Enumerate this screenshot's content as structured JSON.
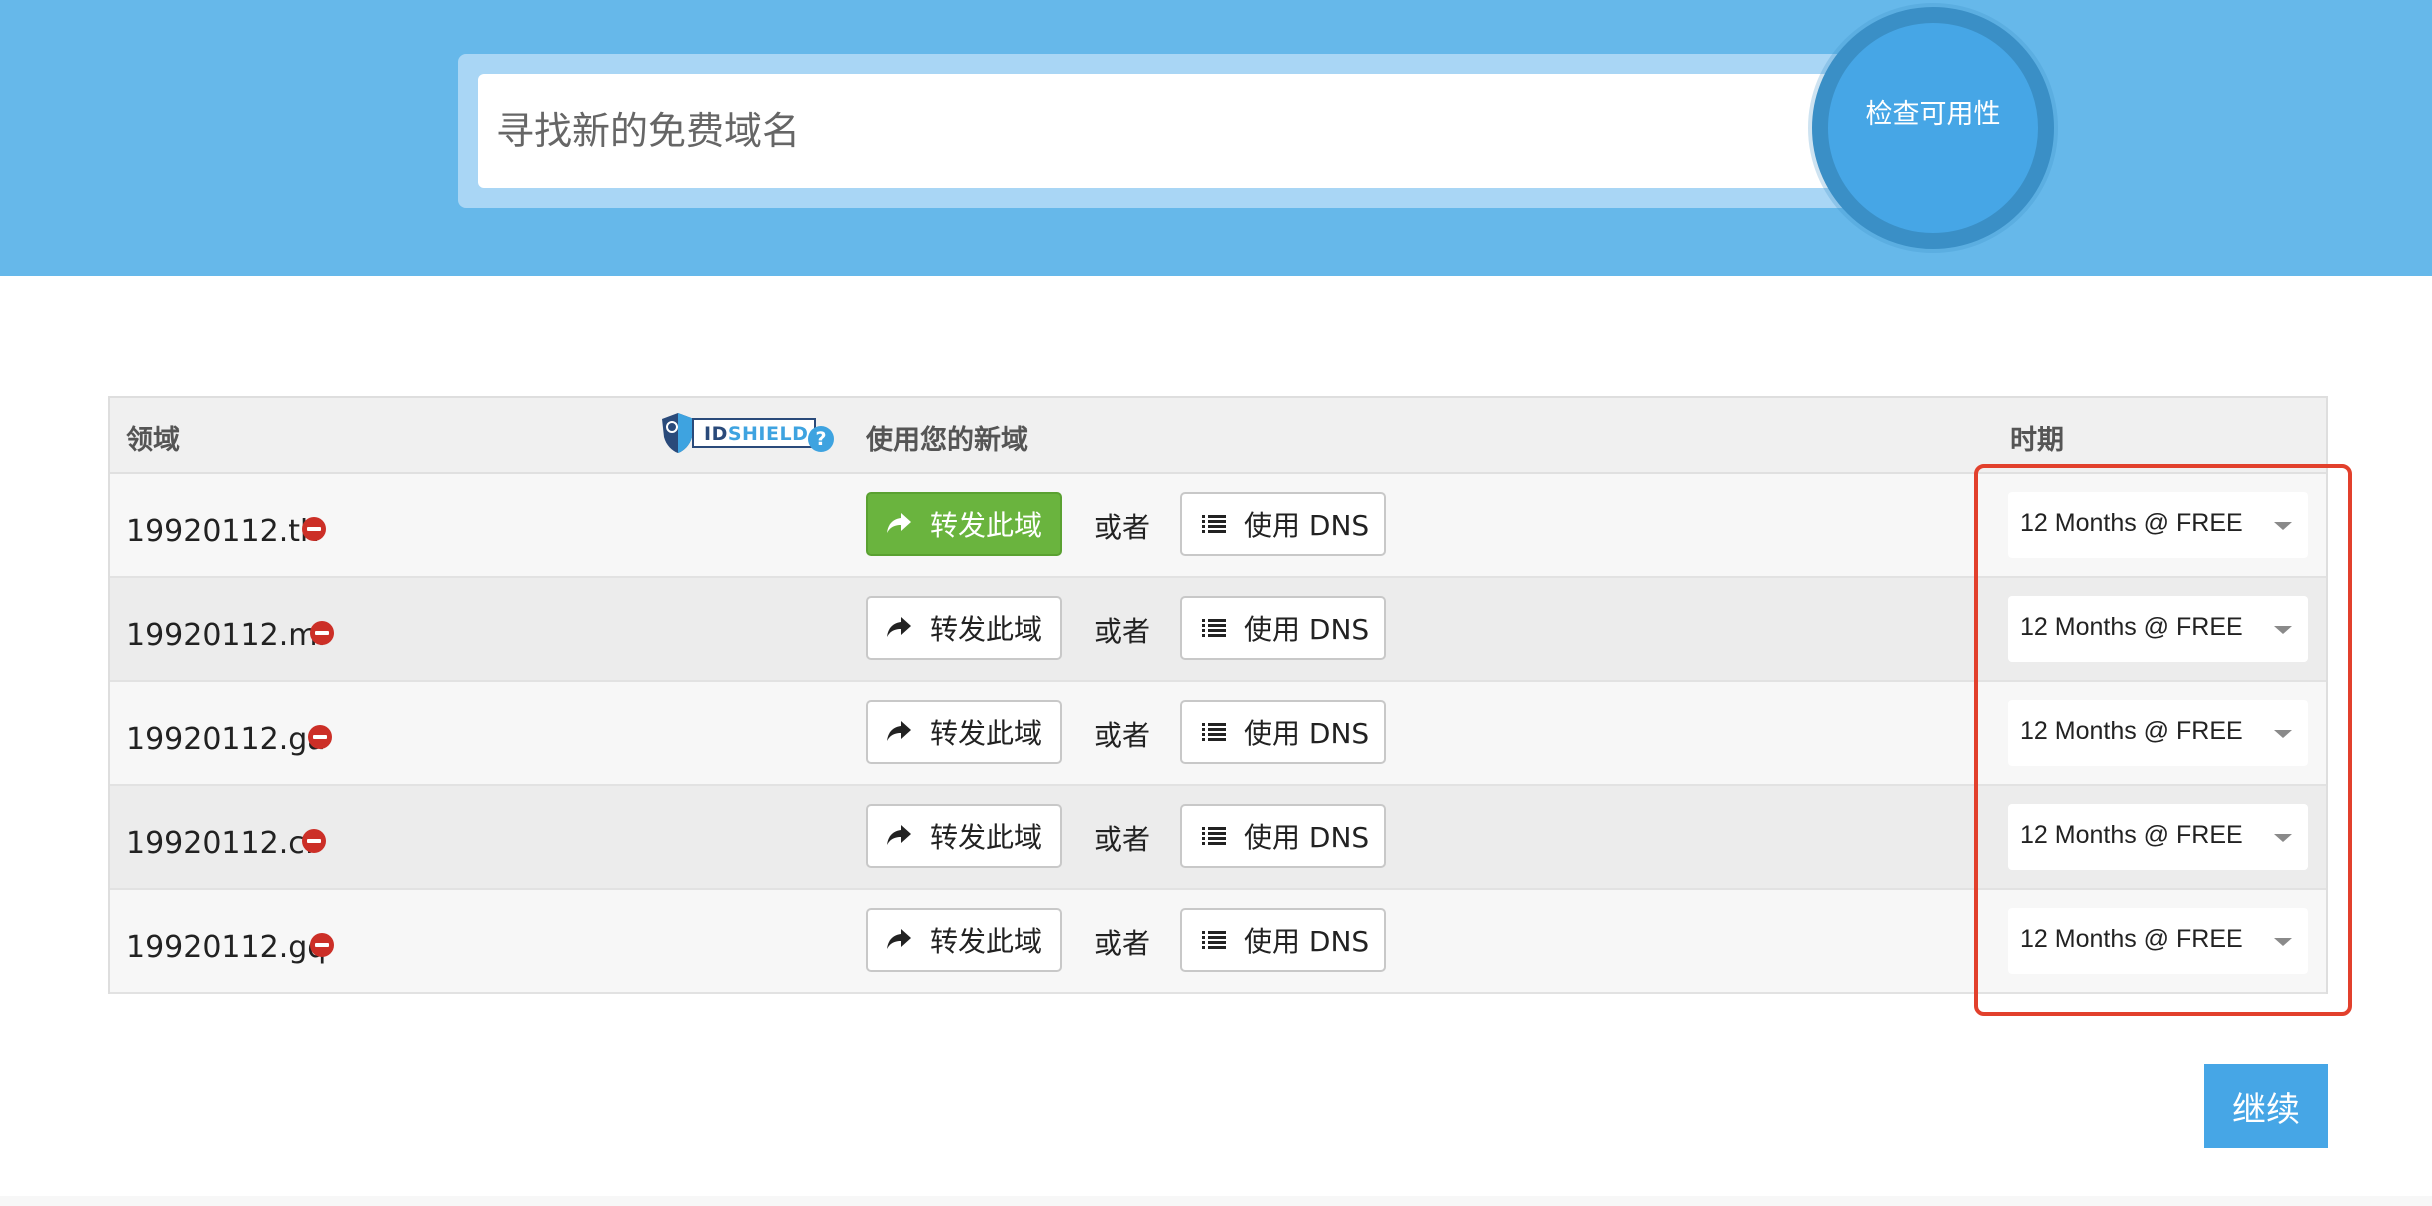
{
  "search": {
    "placeholder": "寻找新的免费域名",
    "check_label": "检查可用性"
  },
  "table": {
    "headers": {
      "domain": "领域",
      "shield_brand_a": "ID",
      "shield_brand_b": "SHIELD",
      "help": "?",
      "use": "使用您的新域",
      "period": "时期"
    },
    "rows": [
      {
        "domain": "19920112.tk",
        "forward_label": "转发此域",
        "or_label": "或者",
        "dns_label": "使用 DNS",
        "period": "12 Months @ FREE",
        "forward_active": true
      },
      {
        "domain": "19920112.ml",
        "forward_label": "转发此域",
        "or_label": "或者",
        "dns_label": "使用 DNS",
        "period": "12 Months @ FREE",
        "forward_active": false
      },
      {
        "domain": "19920112.ga",
        "forward_label": "转发此域",
        "or_label": "或者",
        "dns_label": "使用 DNS",
        "period": "12 Months @ FREE",
        "forward_active": false
      },
      {
        "domain": "19920112.cf",
        "forward_label": "转发此域",
        "or_label": "或者",
        "dns_label": "使用 DNS",
        "period": "12 Months @ FREE",
        "forward_active": false
      },
      {
        "domain": "19920112.gq",
        "forward_label": "转发此域",
        "or_label": "或者",
        "dns_label": "使用 DNS",
        "period": "12 Months @ FREE",
        "forward_active": false
      }
    ]
  },
  "continue_label": "继续",
  "colors": {
    "hero": "#66b8ea",
    "accent_blue": "#46a6e6",
    "forward_active": "#6ab43e",
    "remove_red": "#cc2f27",
    "highlight_red": "#e2402c"
  }
}
